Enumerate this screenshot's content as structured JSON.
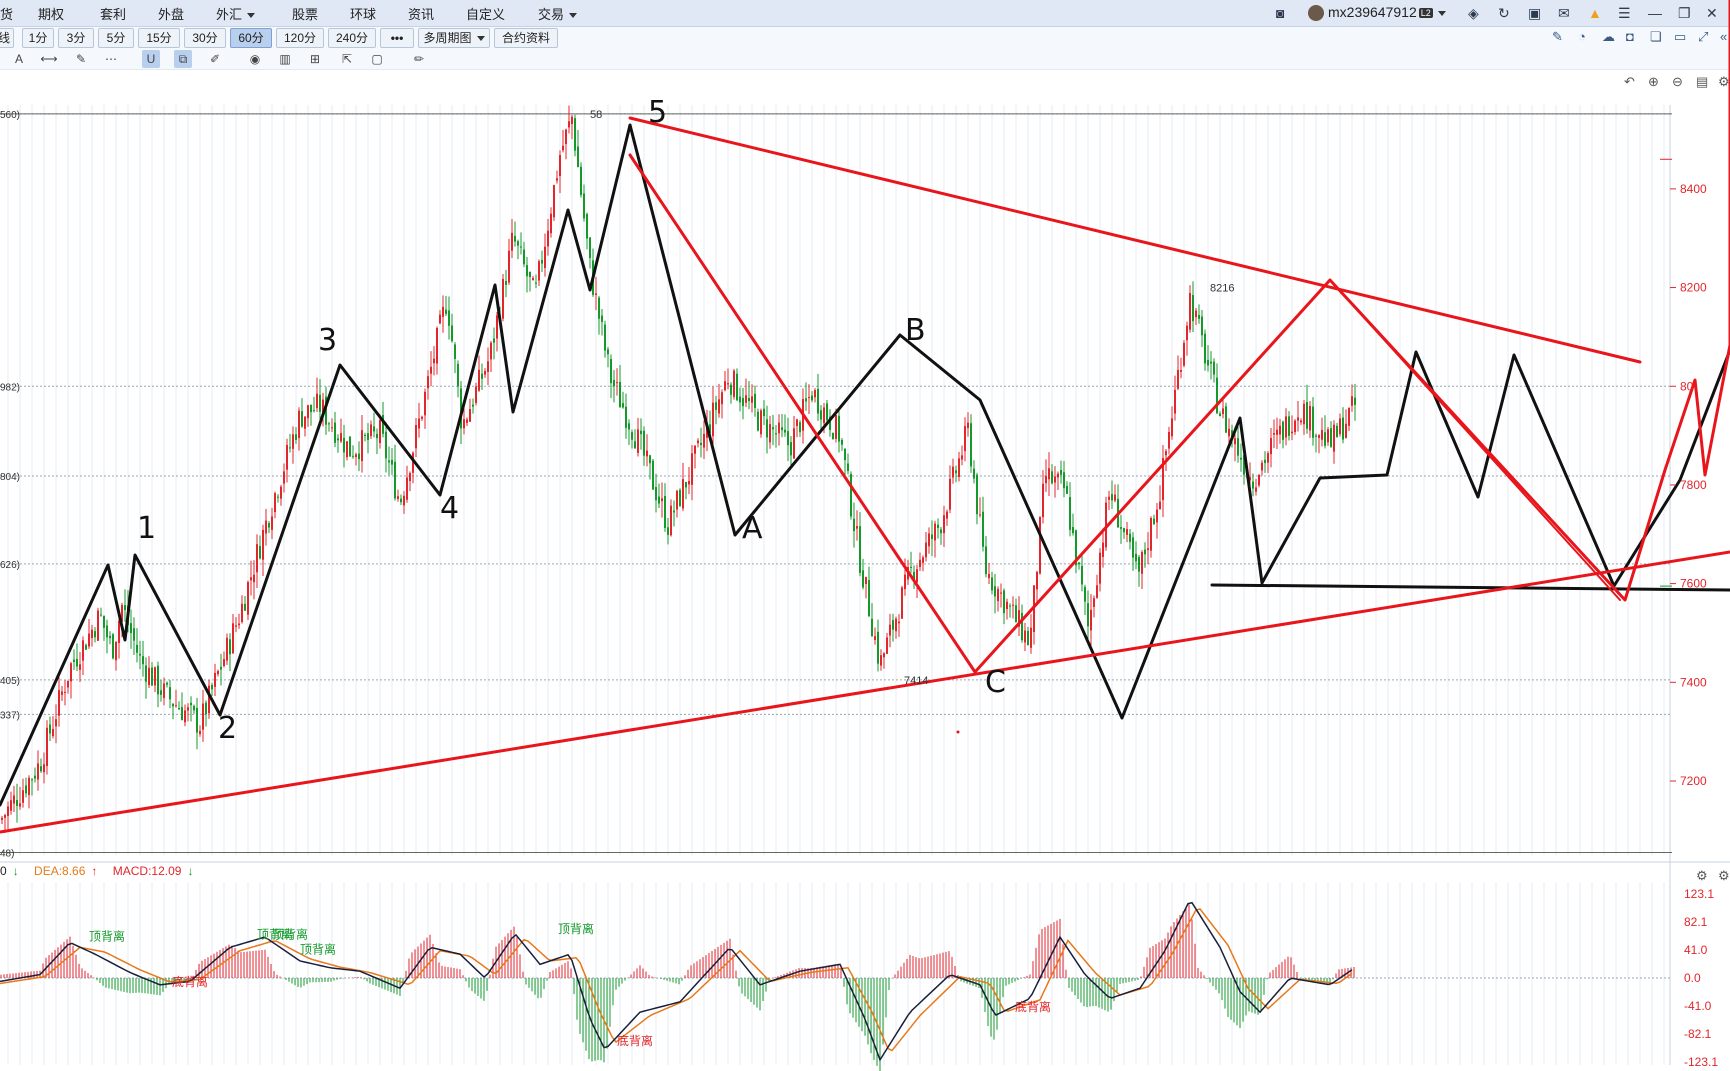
{
  "menu": {
    "items": [
      {
        "label": "货"
      },
      {
        "label": "期权"
      },
      {
        "label": "套利"
      },
      {
        "label": "外盘"
      },
      {
        "label": "外汇"
      },
      {
        "label": "股票"
      },
      {
        "label": "环球"
      },
      {
        "label": "资讯"
      },
      {
        "label": "自定义"
      },
      {
        "label": "交易"
      }
    ],
    "user": "mx239647912",
    "user_badge": "L2"
  },
  "periods": {
    "items": [
      "线",
      "1分",
      "3分",
      "5分",
      "15分",
      "30分",
      "60分",
      "120分",
      "240分",
      "•••",
      "多周期图",
      "合约资料"
    ],
    "active": "60分"
  },
  "colors": {
    "up": "#e2262c",
    "down": "#139a2b",
    "overlay_red": "#e8161c",
    "overlay_black": "#111111",
    "dif": "#1a1f3a",
    "dea": "#e8781a",
    "price_axis": "#e2262c"
  },
  "chart_data": [
    {
      "type": "candlestick",
      "title": "",
      "ylim": [
        7050,
        8570
      ],
      "y_ticks": [
        7200,
        7400,
        7600,
        7800,
        8000,
        8200,
        8400
      ],
      "y_tick_labels": [
        "7200",
        "7400",
        "7600",
        "7800",
        "80",
        "8200",
        "8400"
      ],
      "left_labels": [
        "560)",
        "982)",
        "804)",
        "626)",
        "405)",
        "337)",
        "48)"
      ],
      "markers": [
        {
          "label": "58",
          "value": 8552
        },
        {
          "label": "8216",
          "value": 8200
        },
        {
          "label": "7414",
          "value": 7405
        }
      ],
      "wave_labels": [
        "1",
        "2",
        "3",
        "4",
        "5",
        "A",
        "B",
        "C"
      ],
      "close_series": [
        {
          "x": 0,
          "close": 7120
        },
        {
          "x": 40,
          "close": 7235
        },
        {
          "x": 70,
          "close": 7430
        },
        {
          "x": 100,
          "close": 7535
        },
        {
          "x": 112,
          "close": 7465
        },
        {
          "x": 122,
          "close": 7555
        },
        {
          "x": 140,
          "close": 7445
        },
        {
          "x": 165,
          "close": 7375
        },
        {
          "x": 200,
          "close": 7315
        },
        {
          "x": 240,
          "close": 7540
        },
        {
          "x": 270,
          "close": 7750
        },
        {
          "x": 300,
          "close": 7940
        },
        {
          "x": 320,
          "close": 7960
        },
        {
          "x": 350,
          "close": 7870
        },
        {
          "x": 380,
          "close": 7905
        },
        {
          "x": 400,
          "close": 7765
        },
        {
          "x": 420,
          "close": 7935
        },
        {
          "x": 447,
          "close": 8180
        },
        {
          "x": 462,
          "close": 7920
        },
        {
          "x": 490,
          "close": 8060
        },
        {
          "x": 513,
          "close": 8300
        },
        {
          "x": 535,
          "close": 8180
        },
        {
          "x": 560,
          "close": 8470
        },
        {
          "x": 572,
          "close": 8545
        },
        {
          "x": 590,
          "close": 8240
        },
        {
          "x": 610,
          "close": 8020
        },
        {
          "x": 640,
          "close": 7880
        },
        {
          "x": 668,
          "close": 7720
        },
        {
          "x": 700,
          "close": 7875
        },
        {
          "x": 728,
          "close": 8020
        },
        {
          "x": 760,
          "close": 7930
        },
        {
          "x": 790,
          "close": 7880
        },
        {
          "x": 812,
          "close": 7990
        },
        {
          "x": 840,
          "close": 7900
        },
        {
          "x": 860,
          "close": 7650
        },
        {
          "x": 880,
          "close": 7435
        },
        {
          "x": 910,
          "close": 7620
        },
        {
          "x": 940,
          "close": 7720
        },
        {
          "x": 968,
          "close": 7910
        },
        {
          "x": 985,
          "close": 7630
        },
        {
          "x": 1000,
          "close": 7580
        },
        {
          "x": 1030,
          "close": 7480
        },
        {
          "x": 1045,
          "close": 7820
        },
        {
          "x": 1065,
          "close": 7790
        },
        {
          "x": 1088,
          "close": 7510
        },
        {
          "x": 1110,
          "close": 7790
        },
        {
          "x": 1138,
          "close": 7610
        },
        {
          "x": 1160,
          "close": 7790
        },
        {
          "x": 1190,
          "close": 8180
        },
        {
          "x": 1220,
          "close": 7950
        },
        {
          "x": 1252,
          "close": 7810
        },
        {
          "x": 1275,
          "close": 7890
        },
        {
          "x": 1300,
          "close": 7960
        },
        {
          "x": 1330,
          "close": 7880
        },
        {
          "x": 1355,
          "close": 7960
        }
      ]
    },
    {
      "type": "macd",
      "legend": [
        {
          "label": "0",
          "arrow": "↓",
          "color": "#139a2b"
        },
        {
          "label": "DEA:8.66",
          "arrow": "↑",
          "color": "#e8781a"
        },
        {
          "label": "MACD:12.09",
          "arrow": "↓",
          "color": "#e2262c"
        }
      ],
      "y_ticks": [
        123.1,
        82.1,
        41.0,
        0.0,
        -41.0,
        -82.1,
        -123.1
      ],
      "y_tick_labels": [
        "123.1",
        "82.1",
        "41.0",
        "0.0",
        "-41.0",
        "-82.1",
        "-123.1"
      ],
      "ylim": [
        -123.1,
        123.1
      ],
      "annotations": [
        {
          "label": "顶背离",
          "x": 107,
          "value": 55,
          "color": "#139a2b"
        },
        {
          "label": "底背离",
          "x": 190,
          "value": -12,
          "color": "#e2262c"
        },
        {
          "label": "顶背离",
          "x": 275,
          "value": 58,
          "color": "#139a2b"
        },
        {
          "label": "顶背离",
          "x": 290,
          "value": 58,
          "color": "#139a2b"
        },
        {
          "label": "顶背离",
          "x": 318,
          "value": 36,
          "color": "#139a2b"
        },
        {
          "label": "顶背离",
          "x": 576,
          "value": 66,
          "color": "#139a2b"
        },
        {
          "label": "底背离",
          "x": 635,
          "value": -98,
          "color": "#e2262c"
        },
        {
          "label": "底背离",
          "x": 1033,
          "value": -48,
          "color": "#e2262c"
        }
      ],
      "dif_series": [
        {
          "x": 0,
          "v": -5
        },
        {
          "x": 40,
          "v": 5
        },
        {
          "x": 70,
          "v": 52
        },
        {
          "x": 95,
          "v": 35
        },
        {
          "x": 130,
          "v": 8
        },
        {
          "x": 160,
          "v": -10
        },
        {
          "x": 190,
          "v": -5
        },
        {
          "x": 230,
          "v": 45
        },
        {
          "x": 265,
          "v": 60
        },
        {
          "x": 300,
          "v": 25
        },
        {
          "x": 330,
          "v": 15
        },
        {
          "x": 360,
          "v": 10
        },
        {
          "x": 400,
          "v": -15
        },
        {
          "x": 430,
          "v": 45
        },
        {
          "x": 460,
          "v": 35
        },
        {
          "x": 485,
          "v": 0
        },
        {
          "x": 515,
          "v": 65
        },
        {
          "x": 540,
          "v": 20
        },
        {
          "x": 570,
          "v": 35
        },
        {
          "x": 590,
          "v": -60
        },
        {
          "x": 605,
          "v": -105
        },
        {
          "x": 640,
          "v": -50
        },
        {
          "x": 680,
          "v": -35
        },
        {
          "x": 730,
          "v": 45
        },
        {
          "x": 760,
          "v": -10
        },
        {
          "x": 800,
          "v": 10
        },
        {
          "x": 840,
          "v": 20
        },
        {
          "x": 865,
          "v": -60
        },
        {
          "x": 880,
          "v": -120
        },
        {
          "x": 910,
          "v": -50
        },
        {
          "x": 950,
          "v": 5
        },
        {
          "x": 980,
          "v": -10
        },
        {
          "x": 995,
          "v": -55
        },
        {
          "x": 1030,
          "v": -30
        },
        {
          "x": 1060,
          "v": 60
        },
        {
          "x": 1085,
          "v": 5
        },
        {
          "x": 1110,
          "v": -30
        },
        {
          "x": 1140,
          "v": -15
        },
        {
          "x": 1165,
          "v": 40
        },
        {
          "x": 1190,
          "v": 115
        },
        {
          "x": 1220,
          "v": 45
        },
        {
          "x": 1240,
          "v": -20
        },
        {
          "x": 1260,
          "v": -50
        },
        {
          "x": 1290,
          "v": 0
        },
        {
          "x": 1330,
          "v": -10
        },
        {
          "x": 1355,
          "v": 15
        }
      ],
      "dea_series": [
        {
          "x": 0,
          "v": -8
        },
        {
          "x": 45,
          "v": 2
        },
        {
          "x": 80,
          "v": 45
        },
        {
          "x": 105,
          "v": 38
        },
        {
          "x": 140,
          "v": 12
        },
        {
          "x": 170,
          "v": -6
        },
        {
          "x": 200,
          "v": -2
        },
        {
          "x": 240,
          "v": 40
        },
        {
          "x": 275,
          "v": 55
        },
        {
          "x": 310,
          "v": 28
        },
        {
          "x": 340,
          "v": 16
        },
        {
          "x": 370,
          "v": 8
        },
        {
          "x": 410,
          "v": -10
        },
        {
          "x": 440,
          "v": 40
        },
        {
          "x": 470,
          "v": 32
        },
        {
          "x": 495,
          "v": 5
        },
        {
          "x": 525,
          "v": 58
        },
        {
          "x": 550,
          "v": 25
        },
        {
          "x": 578,
          "v": 30
        },
        {
          "x": 600,
          "v": -50
        },
        {
          "x": 615,
          "v": -95
        },
        {
          "x": 650,
          "v": -55
        },
        {
          "x": 690,
          "v": -30
        },
        {
          "x": 740,
          "v": 40
        },
        {
          "x": 770,
          "v": -5
        },
        {
          "x": 810,
          "v": 8
        },
        {
          "x": 848,
          "v": 15
        },
        {
          "x": 872,
          "v": -50
        },
        {
          "x": 890,
          "v": -110
        },
        {
          "x": 920,
          "v": -55
        },
        {
          "x": 960,
          "v": 2
        },
        {
          "x": 990,
          "v": -8
        },
        {
          "x": 1005,
          "v": -50
        },
        {
          "x": 1040,
          "v": -32
        },
        {
          "x": 1068,
          "v": 55
        },
        {
          "x": 1095,
          "v": 8
        },
        {
          "x": 1120,
          "v": -25
        },
        {
          "x": 1150,
          "v": -12
        },
        {
          "x": 1172,
          "v": 35
        },
        {
          "x": 1198,
          "v": 105
        },
        {
          "x": 1228,
          "v": 48
        },
        {
          "x": 1248,
          "v": -15
        },
        {
          "x": 1268,
          "v": -45
        },
        {
          "x": 1300,
          "v": -2
        },
        {
          "x": 1338,
          "v": -8
        },
        {
          "x": 1355,
          "v": 10
        }
      ]
    }
  ]
}
